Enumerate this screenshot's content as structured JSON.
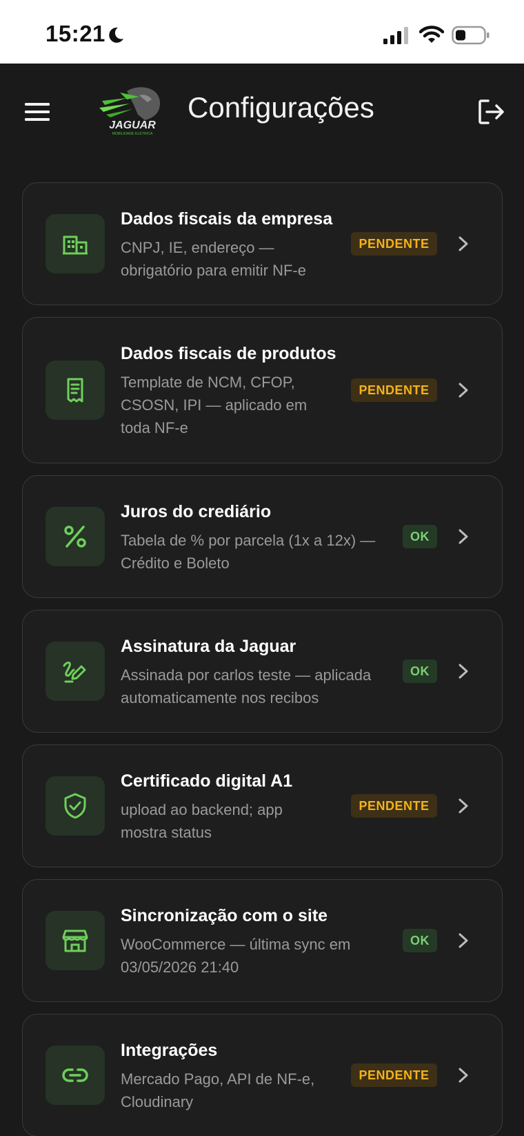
{
  "status_bar": {
    "time": "15:21"
  },
  "header": {
    "title": "Configurações",
    "logo_text": "JAGUAR",
    "logo_subtext": "MOBILIDADE ELÉTRICA"
  },
  "colors": {
    "accent_green": "#6fcf5b",
    "pending": "#f3b21d",
    "ok": "#7ccf74",
    "background": "#1a1a1a"
  },
  "settings": [
    {
      "icon": "building-icon",
      "title": "Dados fiscais da empresa",
      "subtitle": "CNPJ, IE, endereço — obrigatório para emitir NF-e",
      "status": "PENDENTE"
    },
    {
      "icon": "receipt-icon",
      "title": "Dados fiscais de produtos",
      "subtitle": "Template de NCM, CFOP, CSOSN, IPI — aplicado em toda NF-e",
      "status": "PENDENTE"
    },
    {
      "icon": "percent-icon",
      "title": "Juros do crediário",
      "subtitle": "Tabela de % por parcela (1x a 12x) — Crédito e Boleto",
      "status": "OK"
    },
    {
      "icon": "signature-icon",
      "title": "Assinatura da Jaguar",
      "subtitle": "Assinada por carlos teste — aplicada automaticamente nos recibos",
      "status": "OK"
    },
    {
      "icon": "shield-check-icon",
      "title": "Certificado digital A1",
      "subtitle": "upload ao backend; app mostra status",
      "status": "PENDENTE"
    },
    {
      "icon": "store-icon",
      "title": "Sincronização com o site",
      "subtitle": "WooCommerce — última sync em 03/05/2026 21:40",
      "status": "OK"
    },
    {
      "icon": "link-icon",
      "title": "Integrações",
      "subtitle": "Mercado Pago, API de NF-e, Cloudinary",
      "status": "PENDENTE"
    }
  ]
}
